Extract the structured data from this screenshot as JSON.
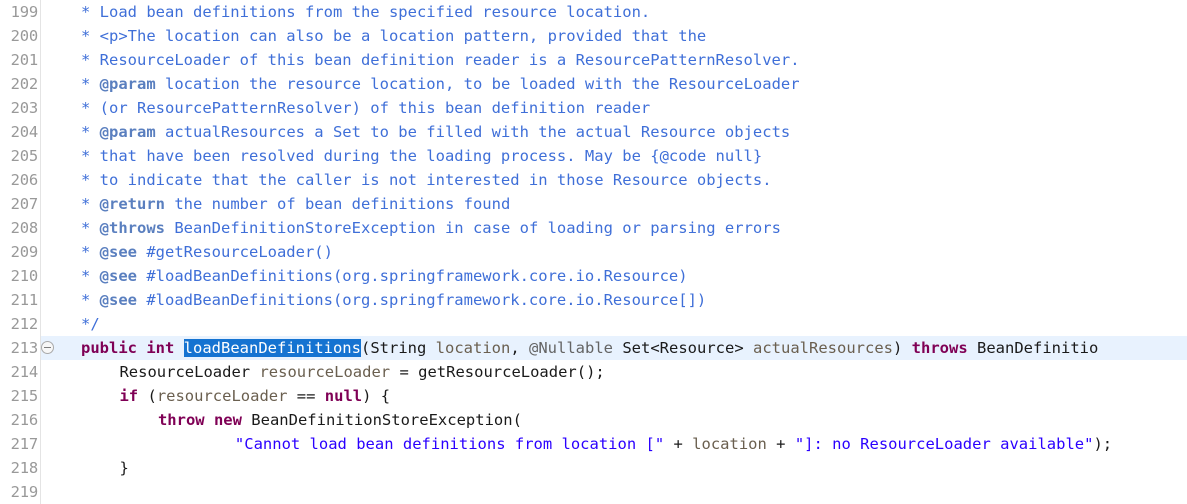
{
  "editor": {
    "name": "java-source-editor",
    "language": "Java",
    "first_line_number": 199,
    "last_line_number": 219,
    "current_line_number": 213,
    "selection_text": "loadBeanDefinitions",
    "colors": {
      "background": "#ffffff",
      "current_line_background": "#e8f2fe",
      "selection_background": "#1573d1",
      "selection_foreground": "#ffffff",
      "line_number": "#999999",
      "javadoc": "#3f6fd8",
      "javadoc_tag": "#5a7fbf",
      "keyword": "#7f0055",
      "string": "#2a00ff",
      "annotation": "#646464",
      "parameter": "#6a5f4f",
      "plain": "#1a1a1a",
      "gutter_rule": "#e4e4e4"
    },
    "fold_marker_line": 213,
    "fold_marker_icon": "collapse-minus-circle-icon"
  },
  "lines": [
    {
      "n": "199",
      "indent": 0,
      "tokens": [
        {
          "t": "* Load bean definitions from the specified resource location.",
          "c": "jdoc"
        }
      ]
    },
    {
      "n": "200",
      "indent": 0,
      "tokens": [
        {
          "t": "* <p>The location can also be a location pattern, provided that the",
          "c": "jdoc"
        }
      ]
    },
    {
      "n": "201",
      "indent": 0,
      "tokens": [
        {
          "t": "* ResourceLoader of this bean definition reader is a ResourcePatternResolver.",
          "c": "jdoc"
        }
      ]
    },
    {
      "n": "202",
      "indent": 0,
      "tokens": [
        {
          "t": "* ",
          "c": "jdoc"
        },
        {
          "t": "@param",
          "c": "jdoctag"
        },
        {
          "t": " location the resource location, to be loaded with the ResourceLoader",
          "c": "jdoc"
        }
      ]
    },
    {
      "n": "203",
      "indent": 0,
      "tokens": [
        {
          "t": "* (or ResourcePatternResolver) of this bean definition reader",
          "c": "jdoc"
        }
      ]
    },
    {
      "n": "204",
      "indent": 0,
      "tokens": [
        {
          "t": "* ",
          "c": "jdoc"
        },
        {
          "t": "@param",
          "c": "jdoctag"
        },
        {
          "t": " actualResources a Set to be filled with the actual Resource objects",
          "c": "jdoc"
        }
      ]
    },
    {
      "n": "205",
      "indent": 0,
      "tokens": [
        {
          "t": "* that have been resolved during the loading process. May be {@code null}",
          "c": "jdoc"
        }
      ]
    },
    {
      "n": "206",
      "indent": 0,
      "tokens": [
        {
          "t": "* to indicate that the caller is not interested in those Resource objects.",
          "c": "jdoc"
        }
      ]
    },
    {
      "n": "207",
      "indent": 0,
      "tokens": [
        {
          "t": "* ",
          "c": "jdoc"
        },
        {
          "t": "@return",
          "c": "jdoctag"
        },
        {
          "t": " the number of bean definitions found",
          "c": "jdoc"
        }
      ]
    },
    {
      "n": "208",
      "indent": 0,
      "tokens": [
        {
          "t": "* ",
          "c": "jdoc"
        },
        {
          "t": "@throws",
          "c": "jdoctag"
        },
        {
          "t": " BeanDefinitionStoreException in case of loading or parsing errors",
          "c": "jdoc"
        }
      ]
    },
    {
      "n": "209",
      "indent": 0,
      "tokens": [
        {
          "t": "* ",
          "c": "jdoc"
        },
        {
          "t": "@see",
          "c": "jdoctag"
        },
        {
          "t": " #getResourceLoader()",
          "c": "jdoclink"
        }
      ]
    },
    {
      "n": "210",
      "indent": 0,
      "tokens": [
        {
          "t": "* ",
          "c": "jdoc"
        },
        {
          "t": "@see",
          "c": "jdoctag"
        },
        {
          "t": " #loadBeanDefinitions(org.springframework.core.io.Resource)",
          "c": "jdoclink"
        }
      ]
    },
    {
      "n": "211",
      "indent": 0,
      "tokens": [
        {
          "t": "* ",
          "c": "jdoc"
        },
        {
          "t": "@see",
          "c": "jdoctag"
        },
        {
          "t": " #loadBeanDefinitions(org.springframework.core.io.Resource[])",
          "c": "jdoclink"
        }
      ]
    },
    {
      "n": "212",
      "indent": 0,
      "tokens": [
        {
          "t": "*/",
          "c": "jdoc"
        }
      ]
    },
    {
      "n": "213",
      "indent": 0,
      "current": true,
      "fold": true,
      "tokens": [
        {
          "t": "public int",
          "c": "kw"
        },
        {
          "t": " ",
          "c": "plain"
        },
        {
          "t": "loadBeanDefinitions",
          "c": "sel"
        },
        {
          "t": "(",
          "c": "plain"
        },
        {
          "t": "String",
          "c": "type"
        },
        {
          "t": " ",
          "c": "plain"
        },
        {
          "t": "location",
          "c": "param"
        },
        {
          "t": ", ",
          "c": "plain"
        },
        {
          "t": "@Nullable",
          "c": "anno"
        },
        {
          "t": " ",
          "c": "plain"
        },
        {
          "t": "Set<Resource>",
          "c": "type"
        },
        {
          "t": " ",
          "c": "plain"
        },
        {
          "t": "actualResources",
          "c": "param"
        },
        {
          "t": ") ",
          "c": "plain"
        },
        {
          "t": "throws",
          "c": "kw"
        },
        {
          "t": " ",
          "c": "plain"
        },
        {
          "t": "BeanDefinitio",
          "c": "type"
        }
      ]
    },
    {
      "n": "214",
      "indent": 1,
      "tokens": [
        {
          "t": "ResourceLoader",
          "c": "type"
        },
        {
          "t": " ",
          "c": "plain"
        },
        {
          "t": "resourceLoader",
          "c": "local"
        },
        {
          "t": " = getResourceLoader();",
          "c": "plain"
        }
      ]
    },
    {
      "n": "215",
      "indent": 1,
      "tokens": [
        {
          "t": "if",
          "c": "kw"
        },
        {
          "t": " (",
          "c": "plain"
        },
        {
          "t": "resourceLoader",
          "c": "local"
        },
        {
          "t": " == ",
          "c": "plain"
        },
        {
          "t": "null",
          "c": "kw"
        },
        {
          "t": ") {",
          "c": "plain"
        }
      ]
    },
    {
      "n": "216",
      "indent": 2,
      "tokens": [
        {
          "t": "throw new",
          "c": "kw"
        },
        {
          "t": " BeanDefinitionStoreException(",
          "c": "plain"
        }
      ]
    },
    {
      "n": "217",
      "indent": 4,
      "tokens": [
        {
          "t": "\"Cannot load bean definitions from location [\"",
          "c": "str"
        },
        {
          "t": " + ",
          "c": "plain"
        },
        {
          "t": "location",
          "c": "param"
        },
        {
          "t": " + ",
          "c": "plain"
        },
        {
          "t": "\"]: no ResourceLoader available\"",
          "c": "str"
        },
        {
          "t": ");",
          "c": "plain"
        }
      ]
    },
    {
      "n": "218",
      "indent": 1,
      "tokens": [
        {
          "t": "}",
          "c": "plain"
        }
      ]
    },
    {
      "n": "219",
      "indent": 0,
      "tokens": []
    }
  ]
}
